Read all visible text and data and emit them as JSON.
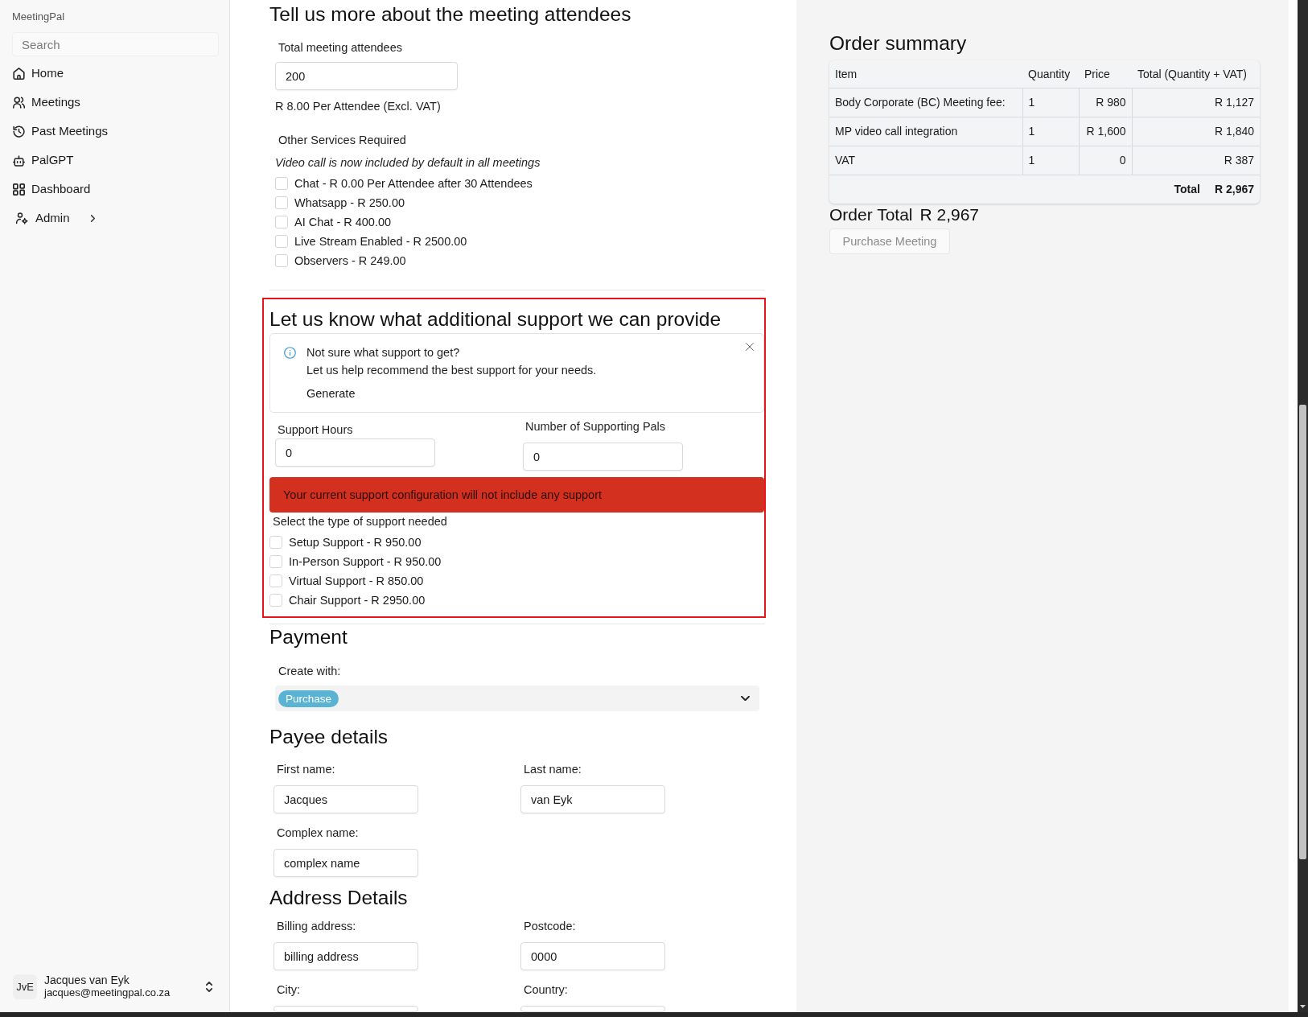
{
  "sidebar": {
    "app_name": "MeetingPal",
    "search": {
      "placeholder": "Search"
    },
    "nav_items": [
      {
        "label": "Home",
        "kind": "link",
        "selected": false
      },
      {
        "label": "Meetings",
        "kind": "link",
        "selected": false
      },
      {
        "label": "Past Meetings",
        "kind": "link",
        "selected": false
      },
      {
        "label": "PalGPT",
        "kind": "link",
        "selected": false
      },
      {
        "label": "Dashboard",
        "kind": "link",
        "selected": false
      },
      {
        "label": "Admin",
        "kind": "group",
        "selected": false,
        "expanded": false
      }
    ],
    "user": {
      "initials": "JvE",
      "name": "Jacques van Eyk",
      "email": "jacques@meetingpal.co.za"
    }
  },
  "attendees": {
    "title": "Tell us more about the meeting attendees",
    "count_field": {
      "label": "Total meeting attendees",
      "value": "200"
    },
    "price_note": "R 8.00 Per Attendee (Excl. VAT)",
    "services": {
      "title": "Other Services Required",
      "note": "Video call is now included by default in all meetings",
      "options": [
        {
          "label": "Chat - R 0.00 Per Attendee after 30 Attendees",
          "checked": false
        },
        {
          "label": "Whatsapp - R 250.00",
          "checked": false
        },
        {
          "label": "AI Chat - R 400.00",
          "checked": false
        },
        {
          "label": "Live Stream Enabled - R 2500.00",
          "checked": false
        },
        {
          "label": "Observers - R 249.00",
          "checked": false
        }
      ]
    }
  },
  "support": {
    "highlighted": true,
    "title": "Let us know what additional support we can provide",
    "recommendation": {
      "title": "Not sure what support to get?",
      "text": "Let us help recommend the best support for your needs.",
      "action": "Generate"
    },
    "hours_field": {
      "label": "Support Hours",
      "value": "0"
    },
    "pals_field": {
      "label": "Number of Supporting Pals",
      "value": "0"
    },
    "warning": "Your current support configuration will not include any support",
    "types": {
      "title": "Select the type of support needed",
      "options": [
        {
          "label": "Setup Support - R 950.00",
          "checked": false
        },
        {
          "label": "In-Person Support - R 950.00",
          "checked": false
        },
        {
          "label": "Virtual Support - R 850.00",
          "checked": false
        },
        {
          "label": "Chair Support - R 2950.00",
          "checked": false
        }
      ]
    }
  },
  "payment": {
    "title": "Payment",
    "create_with": {
      "label": "Create with:",
      "selected_tags": [
        "Purchase"
      ]
    }
  },
  "payee": {
    "title": "Payee details",
    "fields": [
      {
        "label": "First name:",
        "value": "Jacques"
      },
      {
        "label": "Last name:",
        "value": "van Eyk"
      },
      {
        "label": "Complex name:",
        "value": "complex name"
      }
    ]
  },
  "address": {
    "title": "Address Details",
    "fields": [
      {
        "label": "Billing address:",
        "value": "billing address"
      },
      {
        "label": "Postcode:",
        "value": "0000"
      },
      {
        "label": "City:"
      },
      {
        "label": "Country:"
      }
    ]
  },
  "order_summary": {
    "title": "Order summary",
    "table": {
      "columns": [
        "Item",
        "Quantity",
        "Price",
        "Total (Quantity + VAT)"
      ],
      "rows": [
        [
          "Body Corporate (BC) Meeting fee:",
          "1",
          "R 980",
          "R 1,127"
        ],
        [
          "MP video call integration",
          "1",
          "R 1,600",
          "R 1,840"
        ],
        [
          "VAT",
          "1",
          "0",
          "R 387"
        ]
      ],
      "footer": {
        "label": "Total",
        "value": "R 2,967"
      }
    },
    "order_total": {
      "label": "Order Total",
      "value": "R 2,967"
    },
    "purchase_button": {
      "label": "Purchase Meeting",
      "disabled": true
    }
  }
}
